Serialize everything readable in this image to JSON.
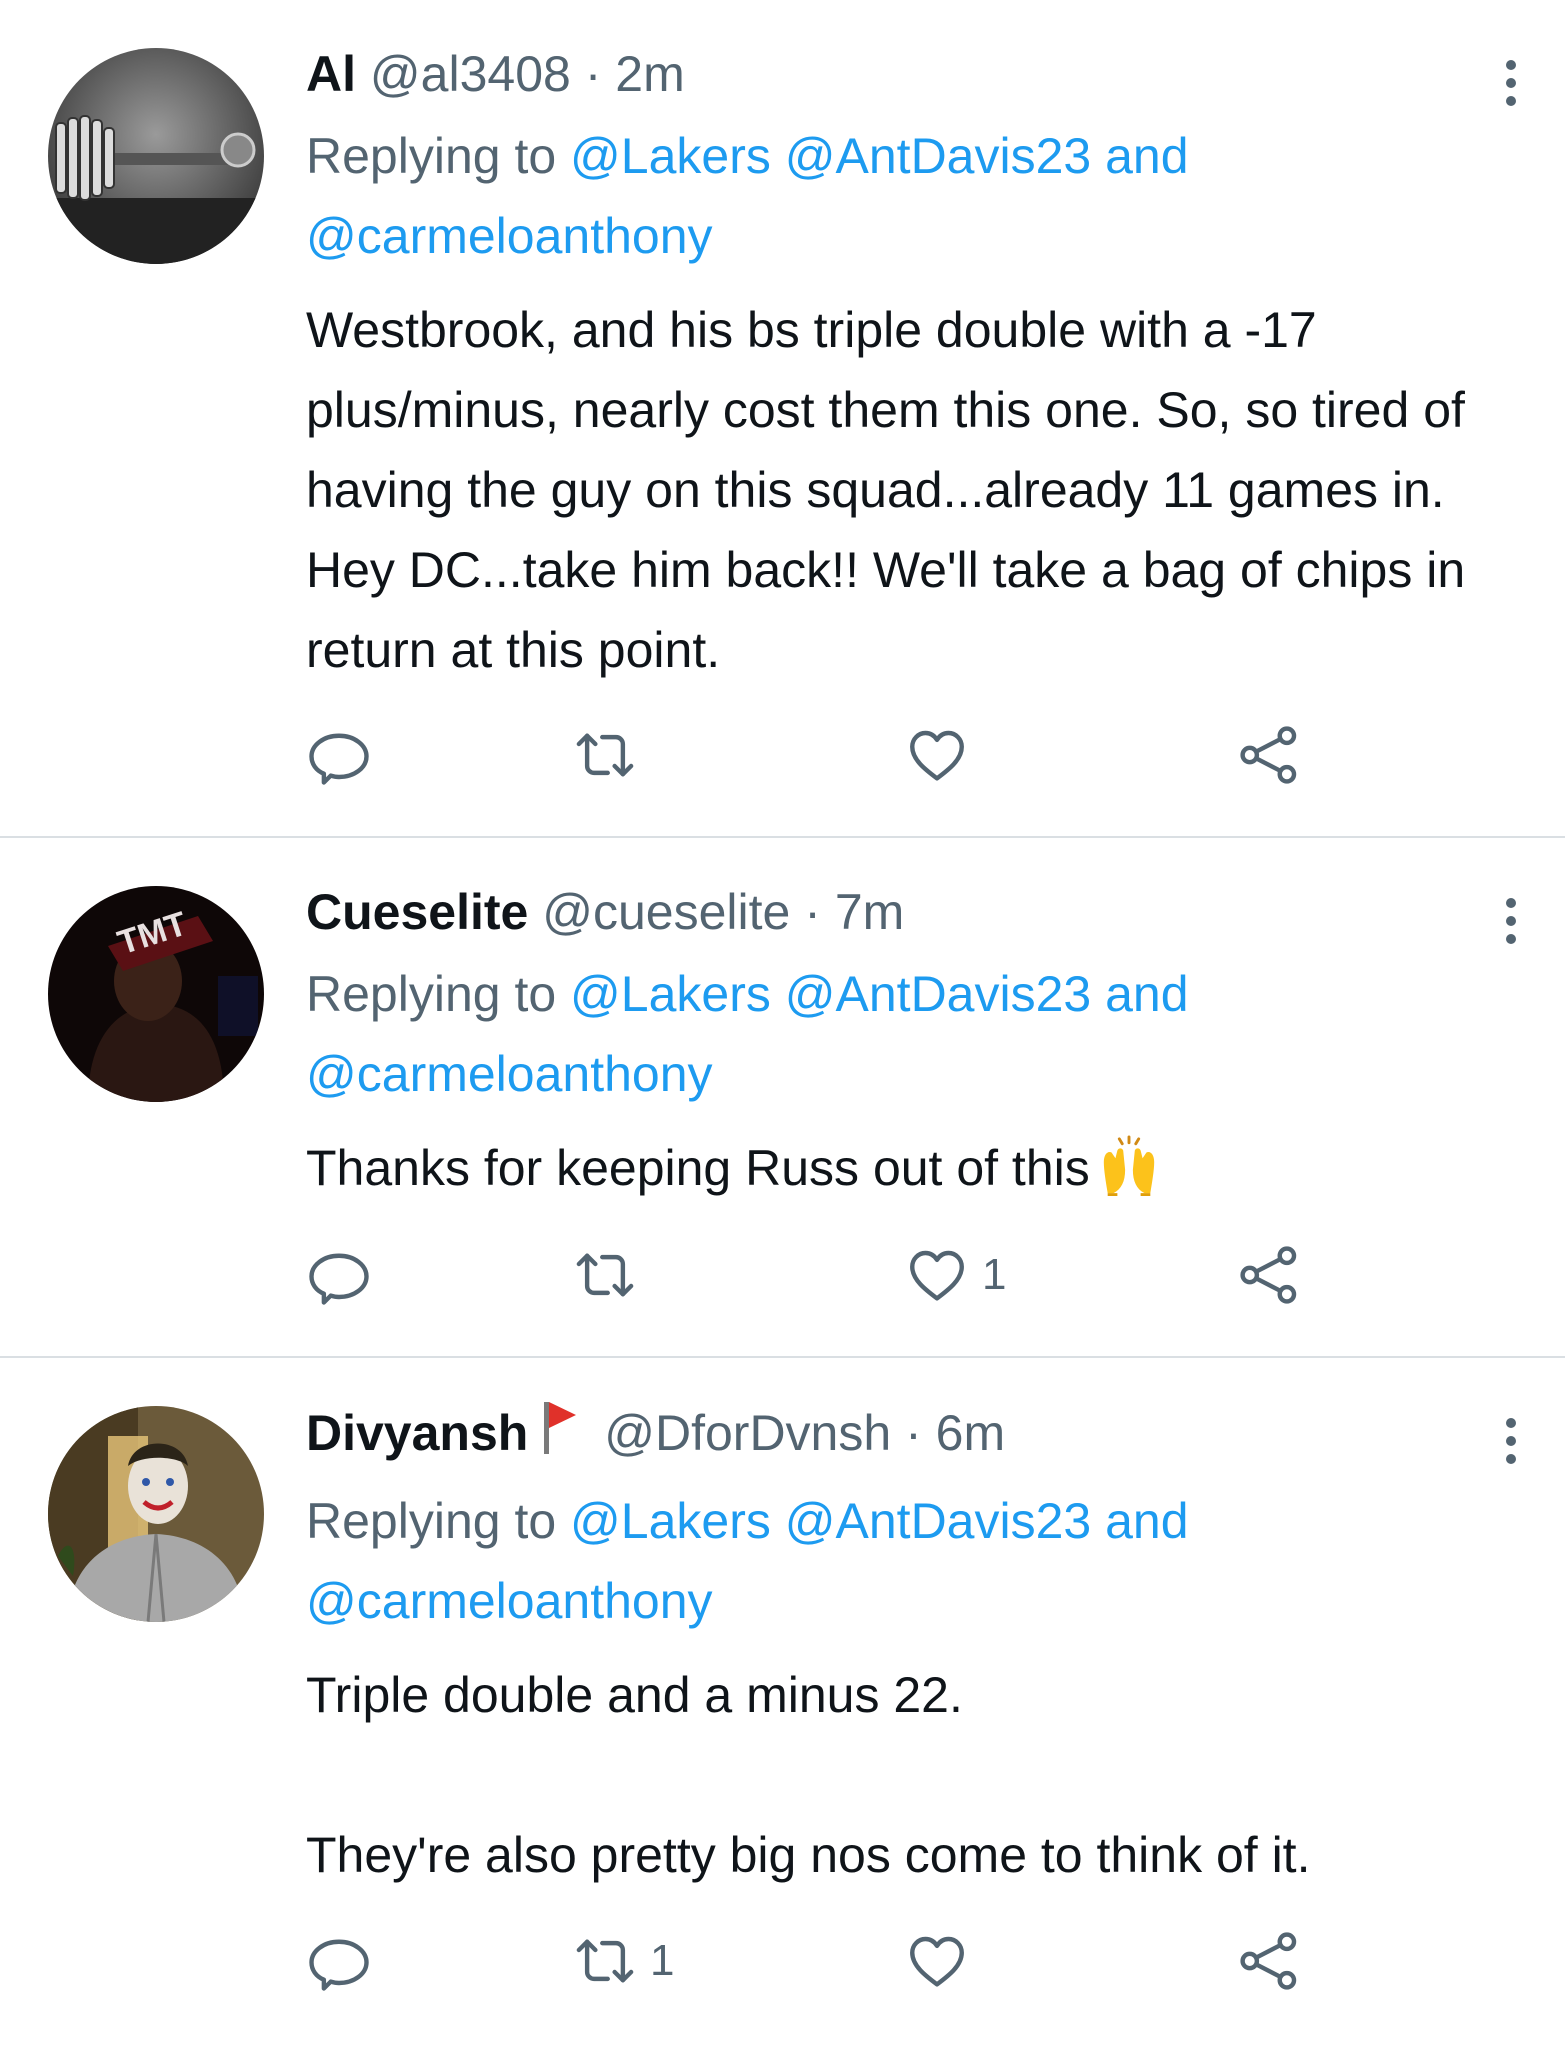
{
  "tweets": [
    {
      "name": "Al",
      "handle": "@al3408",
      "separator": "·",
      "time": "2m",
      "replying_prefix": "Replying to ",
      "reply_line1_links": "@Lakers @AntDavis23 and",
      "reply_line2_link": "@carmeloanthony",
      "text": "Westbrook, and his bs triple double with a -17 plus/minus, nearly cost them this one. So, so tired of having the guy on this squad...already 11 games in. Hey DC...take him back!! We'll take a bag of chips in return at this point.",
      "retweets": "",
      "likes": ""
    },
    {
      "name": "Cueselite",
      "handle": "@cueselite",
      "separator": "·",
      "time": "7m",
      "replying_prefix": "Replying to ",
      "reply_line1_links": "@Lakers @AntDavis23 and",
      "reply_line2_link": "@carmeloanthony",
      "text": "Thanks for keeping Russ out of this",
      "emoji": "raising-hands-emoji",
      "retweets": "",
      "likes": "1"
    },
    {
      "name": "Divyansh",
      "name_badge": "red-flag-emoji",
      "handle": "@DforDvnsh",
      "separator": "·",
      "time": "6m",
      "replying_prefix": "Replying to ",
      "reply_line1_links": "@Lakers @AntDavis23 and",
      "reply_line2_link": "@carmeloanthony",
      "text": "Triple double and a minus 22.\n\nThey're also pretty big nos come to think of it.",
      "retweets": "1",
      "likes": ""
    }
  ],
  "icons": {
    "more": "more-vertical-icon",
    "reply": "reply-icon",
    "retweet": "retweet-icon",
    "like": "heart-icon",
    "share": "share-icon"
  },
  "colors": {
    "link": "#1d9bf0",
    "secondary_text": "#536471",
    "primary_text": "#0f1419",
    "divider": "#dadfe3"
  }
}
